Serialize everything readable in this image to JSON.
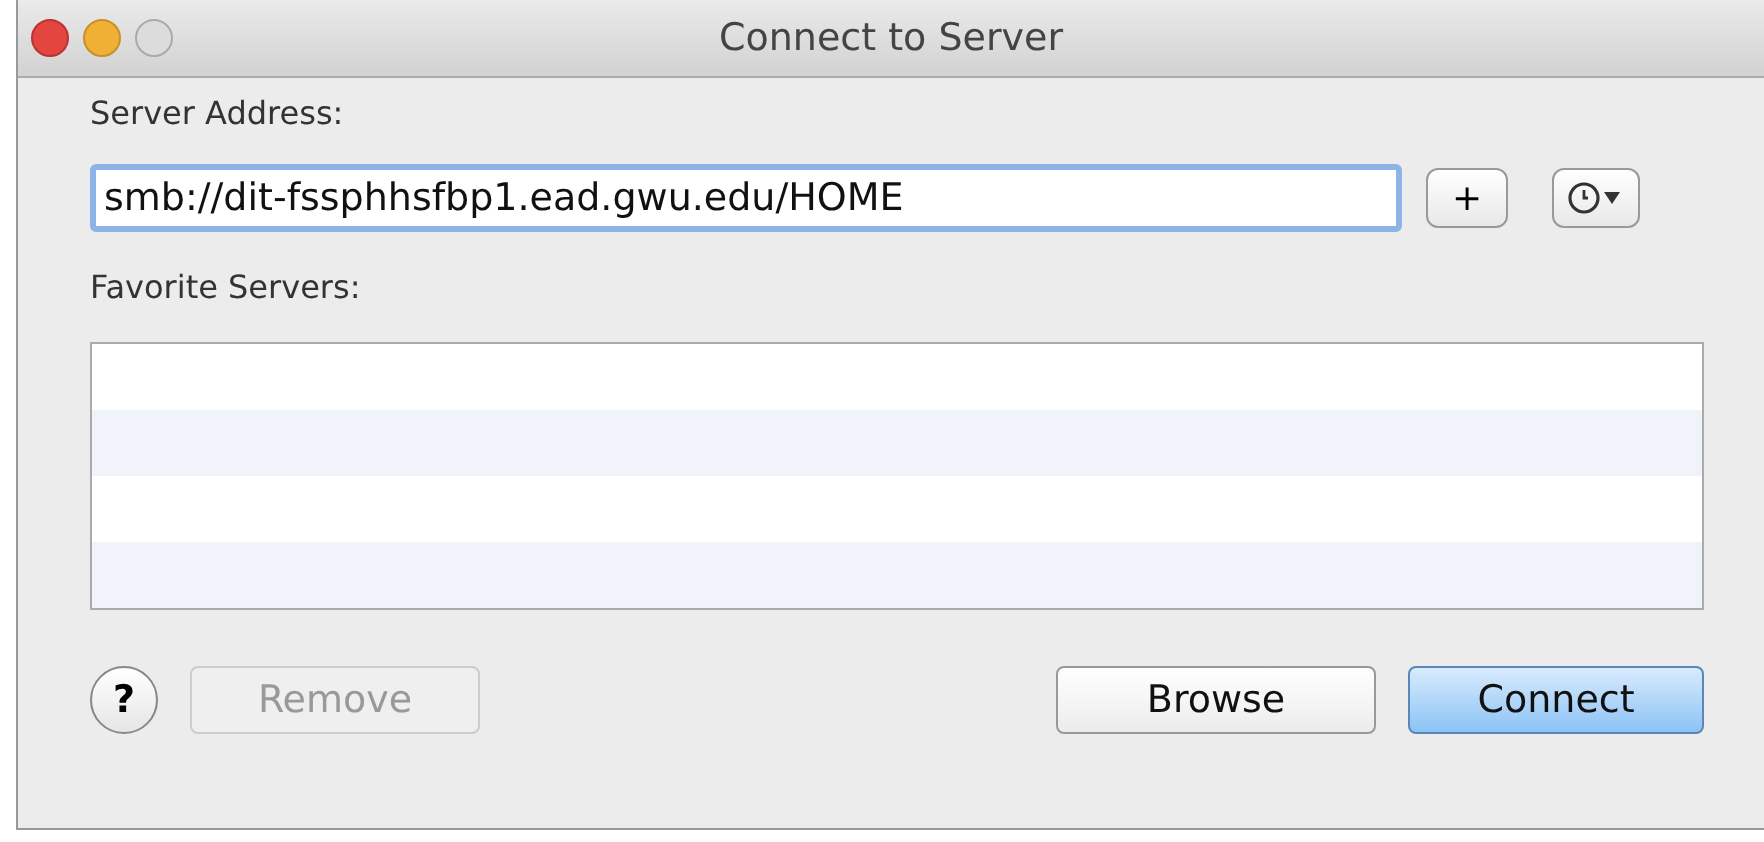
{
  "window": {
    "title": "Connect to Server"
  },
  "server_address": {
    "label": "Server Address:",
    "value": "smb://dit-fssphhsfbp1.ead.gwu.edu/HOME",
    "add_button": "+"
  },
  "favorites": {
    "label": "Favorite Servers:"
  },
  "help_button": "?",
  "buttons": [
    {
      "label": "Remove",
      "disabled": true,
      "default": false
    },
    {
      "label": "Browse",
      "disabled": false,
      "default": false
    },
    {
      "label": "Connect",
      "disabled": false,
      "default": true
    }
  ]
}
